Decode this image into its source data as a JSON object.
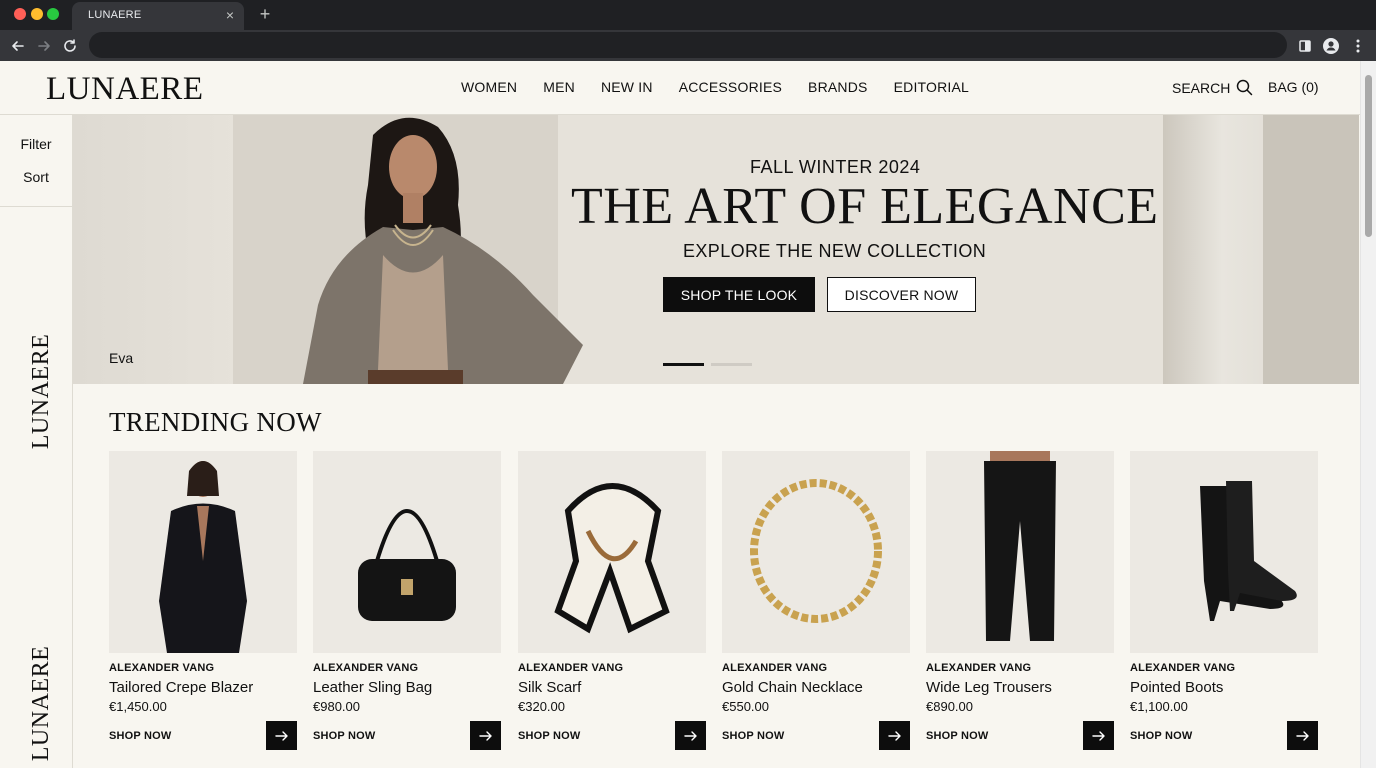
{
  "browser": {
    "tab_title": "LUNAERE",
    "new_tab_icon": "plus-icon",
    "close_icon": "close-icon"
  },
  "header": {
    "logo": "LUNAERE",
    "nav": [
      {
        "label": "WOMEN"
      },
      {
        "label": "MEN"
      },
      {
        "label": "NEW IN"
      },
      {
        "label": "ACCESSORIES"
      },
      {
        "label": "BRANDS"
      },
      {
        "label": "EDITORIAL"
      }
    ],
    "search_label": "SEARCH",
    "bag_label": "BAG (0)"
  },
  "sidebar": {
    "filter_label": "Filter",
    "sort_label": "Sort",
    "vertical_logo": "LUNAERE"
  },
  "hero": {
    "season": "FALL WINTER 2024",
    "title": "THE ART OF ELEGANCE",
    "subtitle": "EXPLORE THE NEW COLLECTION",
    "primary_cta": "SHOP THE LOOK",
    "secondary_cta": "DISCOVER NOW",
    "model_label": "Eva",
    "slides_total": 2,
    "active_slide": 1
  },
  "trending": {
    "title": "TRENDING NOW",
    "products": [
      {
        "brand": "ALEXANDER VANG",
        "name": "Tailored Crepe Blazer",
        "price": "€1,450.00",
        "cta": "SHOP NOW",
        "image": "blazer"
      },
      {
        "brand": "ALEXANDER VANG",
        "name": "Leather Sling Bag",
        "price": "€980.00",
        "cta": "SHOP NOW",
        "image": "bag"
      },
      {
        "brand": "ALEXANDER VANG",
        "name": "Silk Scarf",
        "price": "€320.00",
        "cta": "SHOP NOW",
        "image": "scarf"
      },
      {
        "brand": "ALEXANDER VANG",
        "name": "Gold Chain Necklace",
        "price": "€550.00",
        "cta": "SHOP NOW",
        "image": "necklace"
      },
      {
        "brand": "ALEXANDER VANG",
        "name": "Wide Leg Trousers",
        "price": "€890.00",
        "cta": "SHOP NOW",
        "image": "trousers"
      },
      {
        "brand": "ALEXANDER VANG",
        "name": "Pointed Boots",
        "price": "€1,100.00",
        "cta": "SHOP NOW",
        "image": "boots"
      }
    ]
  },
  "colors": {
    "page_bg": "#f8f6f0",
    "ink": "#111111",
    "accent_dark": "#0d0d0d"
  }
}
